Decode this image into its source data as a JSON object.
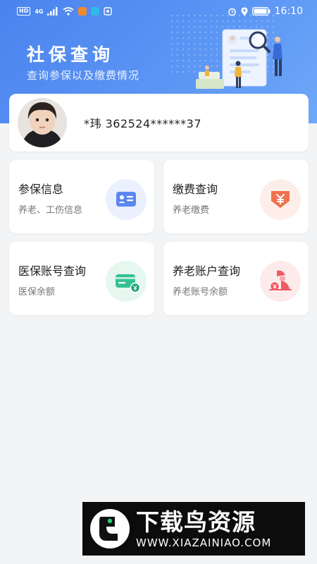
{
  "status_bar": {
    "network_badge_hd": "HD",
    "network_badge_4g": "4G",
    "time": "16:10"
  },
  "header": {
    "title": "社保查询",
    "subtitle": "查询参保以及缴费情况"
  },
  "user": {
    "masked_id": "*玮 362524******37"
  },
  "tiles": [
    {
      "title": "参保信息",
      "subtitle": "养老、工伤信息",
      "icon": "id-card-icon",
      "color": "#5b87f0"
    },
    {
      "title": "缴费查询",
      "subtitle": "养老缴费",
      "icon": "yuan-payment-icon",
      "color": "#f0724e"
    },
    {
      "title": "医保账号查询",
      "subtitle": "医保余额",
      "icon": "medical-card-icon",
      "color": "#34c293"
    },
    {
      "title": "养老账户查询",
      "subtitle": "养老账号余额",
      "icon": "pension-account-icon",
      "color": "#ef5b62"
    }
  ],
  "watermark": {
    "brand": "下载鸟资源",
    "url": "WWW.XIAZAINIAO.COM"
  }
}
